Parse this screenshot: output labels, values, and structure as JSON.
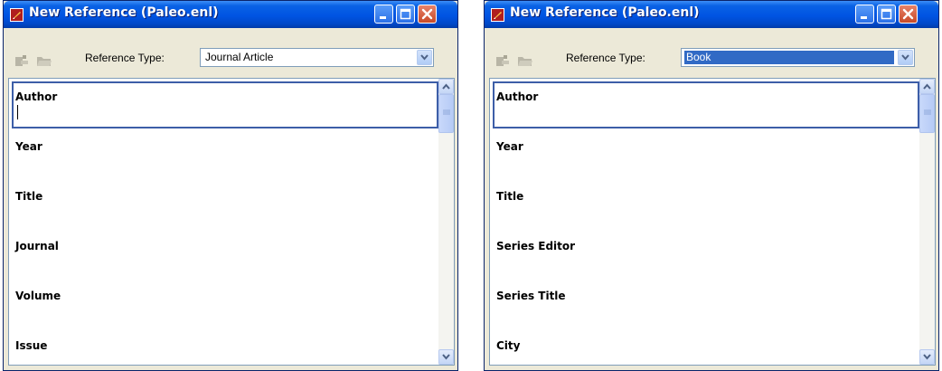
{
  "windows": [
    {
      "title": "New Reference (Paleo.enl)",
      "reference_type_label": "Reference Type:",
      "reference_type_value": "Journal Article",
      "fields": [
        "Author",
        "Year",
        "Title",
        "Journal",
        "Volume",
        "Issue"
      ]
    },
    {
      "title": "New Reference (Paleo.enl)",
      "reference_type_label": "Reference Type:",
      "reference_type_value": "Book",
      "fields": [
        "Author",
        "Year",
        "Title",
        "Series Editor",
        "Series Title",
        "City"
      ]
    }
  ],
  "icons": {
    "app": "endnote-app-icon",
    "minimize": "minimize-icon",
    "maximize": "maximize-icon",
    "close": "close-icon",
    "toolbar_1": "prev-reference-icon",
    "toolbar_2": "open-folder-icon",
    "dropdown": "chevron-down-icon",
    "scroll_up": "scroll-up-icon",
    "scroll_down": "scroll-down-icon"
  },
  "colors": {
    "titlebar": "#0054e3",
    "close_button": "#c84a28",
    "selection": "#316ac5",
    "active_field_border": "#3d5ea8"
  }
}
